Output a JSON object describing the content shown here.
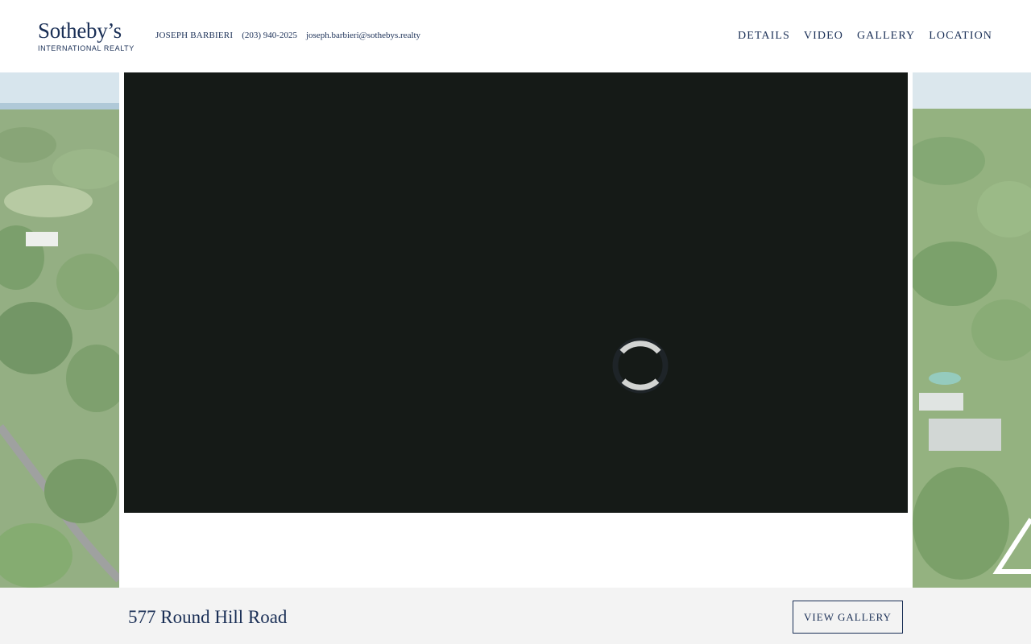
{
  "brand": {
    "wordmark": "Sotheby’s",
    "subtitle": "INTERNATIONAL REALTY",
    "color": "#1a2f56"
  },
  "agent": {
    "name": "JOSEPH BARBIERI",
    "phone": "(203) 940-2025",
    "email": "joseph.barbieri@sothebys.realty"
  },
  "nav": {
    "items": [
      {
        "label": "DETAILS"
      },
      {
        "label": "VIDEO"
      },
      {
        "label": "GALLERY"
      },
      {
        "label": "LOCATION"
      }
    ]
  },
  "video": {
    "state": "loading",
    "icon": "loading-spinner-icon",
    "background": "#151a17"
  },
  "footer": {
    "address": "577 Round Hill Road",
    "button_label": "VIEW GALLERY",
    "background": "#f3f3f3"
  },
  "side_panels": {
    "left_icon": "aerial-photo-left",
    "right_icon": "aerial-photo-right"
  }
}
